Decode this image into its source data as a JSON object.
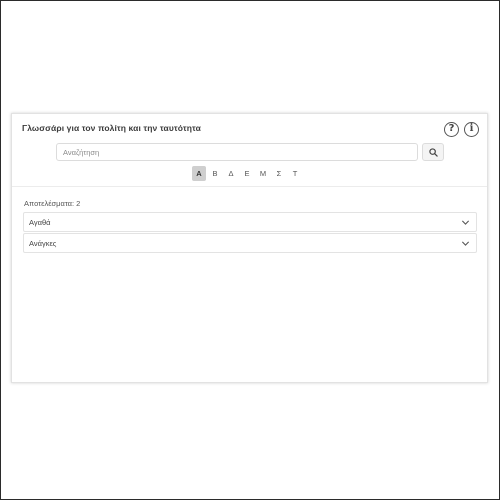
{
  "widget": {
    "title": "Γλωσσάρι για τον πολίτη και την ταυτότητα",
    "help_glyph": "?",
    "info_glyph": "i",
    "help_icon": "question-circle-icon",
    "info_icon": "info-circle-icon"
  },
  "search": {
    "placeholder": "Αναζήτηση",
    "value": "",
    "button_icon": "search-icon"
  },
  "alphabet": {
    "letters": [
      "Α",
      "Β",
      "Δ",
      "Ε",
      "Μ",
      "Σ",
      "Τ"
    ],
    "selected": "Α"
  },
  "results": {
    "count_label": "Αποτελέσματα: 2",
    "items": [
      {
        "label": "Αγαθά",
        "icon": "chevron-down-icon"
      },
      {
        "label": "Ανάγκες",
        "icon": "chevron-down-icon"
      }
    ]
  },
  "colors": {
    "active_letter_bg": "#cfcfcf",
    "border": "#e3e3e3",
    "title_text": "#3a3a3a"
  }
}
